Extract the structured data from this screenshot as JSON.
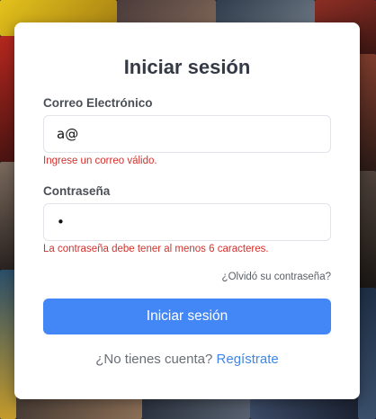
{
  "form": {
    "title": "Iniciar sesión",
    "email": {
      "label": "Correo Electrónico",
      "value": "a@",
      "error": "Ingrese un correo válido."
    },
    "password": {
      "label": "Contraseña",
      "value": "•",
      "error": "La contraseña debe tener al menos 6 caracteres."
    },
    "forgot_link": "¿Olvidó su contraseña?",
    "submit_label": "Iniciar sesión",
    "signup_prompt": "¿No tienes cuenta?",
    "signup_link": "Regístrate"
  },
  "colors": {
    "primary": "#4287f5",
    "error": "#d2312c",
    "link": "#3f86e8"
  }
}
